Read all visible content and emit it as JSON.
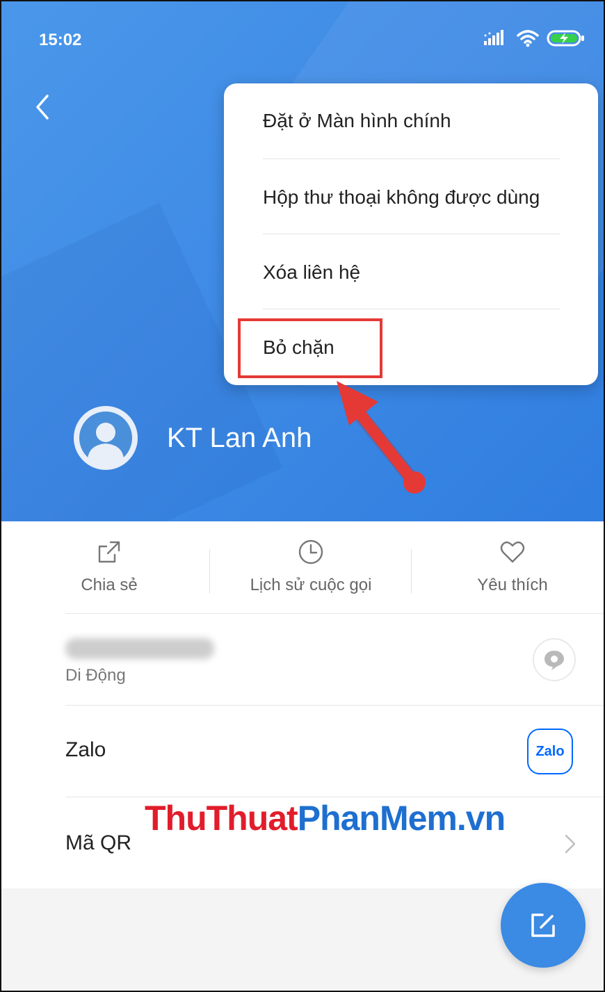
{
  "status_bar": {
    "time": "15:02",
    "icons": [
      "signal-icon",
      "wifi-icon",
      "battery-charging-icon"
    ]
  },
  "contact": {
    "name": "KT Lan Anh"
  },
  "menu": {
    "items": [
      "Đặt ở Màn hình chính",
      "Hộp thư thoại không được dùng",
      "Xóa liên hệ",
      "Bỏ chặn"
    ],
    "highlighted_item": "Bỏ chặn"
  },
  "actions": [
    {
      "label": "Chia sẻ",
      "icon": "share-icon"
    },
    {
      "label": "Lịch sử cuộc gọi",
      "icon": "clock-icon"
    },
    {
      "label": "Yêu thích",
      "icon": "heart-icon"
    }
  ],
  "phone_row": {
    "type_label": "Di Động",
    "action_icon": "message-icon"
  },
  "zalo_row": {
    "label": "Zalo",
    "logo_text": "Zalo"
  },
  "qr_row": {
    "label": "Mã QR"
  },
  "watermark": {
    "part1": "ThuThuat",
    "part2": "PhanMem.vn"
  },
  "colors": {
    "header_blue": "#3f8be6",
    "annotation_red": "#e53935",
    "zalo_blue": "#0068ff"
  }
}
